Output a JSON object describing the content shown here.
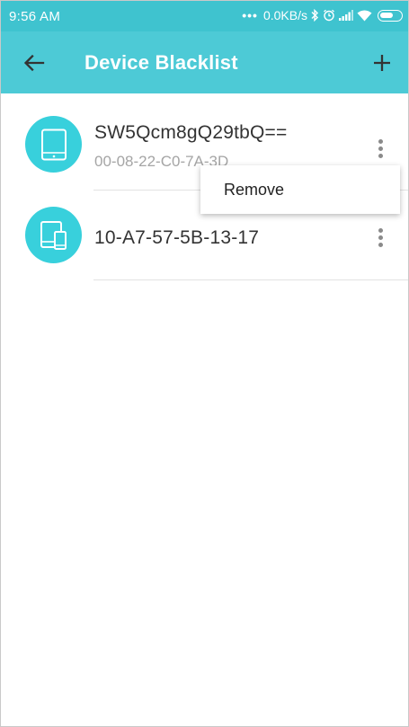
{
  "statusbar": {
    "time": "9:56 AM",
    "net_speed": "0.0KB/s",
    "icons": [
      "bluetooth-icon",
      "alarm-icon",
      "signal-icon",
      "wifi-icon",
      "battery-icon"
    ]
  },
  "appbar": {
    "title": "Device Blacklist",
    "back_icon": "arrow-left-icon",
    "add_icon": "plus-icon",
    "background": "#4dcad6"
  },
  "devices": [
    {
      "name": "SW5Qcm8gQ29tbQ==",
      "mac": "00-08-22-C0-7A-3D",
      "icon": "tablet-icon"
    },
    {
      "name": "10-A7-57-5B-13-17",
      "mac": "",
      "icon": "multi-device-icon"
    }
  ],
  "popup_menu": {
    "items": [
      "Remove"
    ]
  },
  "colors": {
    "accent": "#38d0dc",
    "statusbar": "#3fc3cf"
  }
}
